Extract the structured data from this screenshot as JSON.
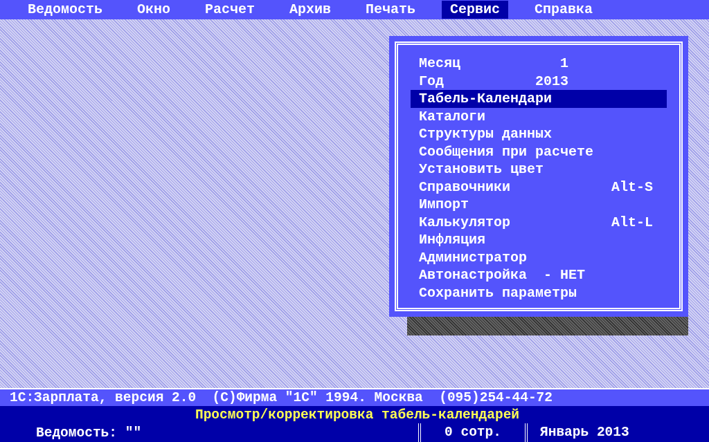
{
  "menu_bar": [
    {
      "label": "Ведомость",
      "selected": false
    },
    {
      "label": "Окно",
      "selected": false
    },
    {
      "label": "Расчет",
      "selected": false
    },
    {
      "label": "Архив",
      "selected": false
    },
    {
      "label": "Печать",
      "selected": false
    },
    {
      "label": "Сервис",
      "selected": true
    },
    {
      "label": "Справка",
      "selected": false
    }
  ],
  "dropdown": {
    "items": [
      {
        "label": "Месяц",
        "value": "1",
        "selected": false
      },
      {
        "label": "Год",
        "value": "2013",
        "selected": false
      },
      {
        "label": "Табель-Календари",
        "selected": true
      },
      {
        "label": "Каталоги",
        "selected": false
      },
      {
        "label": "Структуры данных",
        "selected": false
      },
      {
        "label": "Сообщения при расчете",
        "selected": false
      },
      {
        "label": "Установить цвет",
        "selected": false
      },
      {
        "label": "Справочники",
        "shortcut": "Alt-S",
        "selected": false
      },
      {
        "label": "Импорт",
        "selected": false
      },
      {
        "label": "Калькулятор",
        "shortcut": "Alt-L",
        "selected": false
      },
      {
        "label": "Инфляция",
        "selected": false
      },
      {
        "label": "Администратор",
        "selected": false
      },
      {
        "label": "Автонастройка  - НЕТ",
        "selected": false
      },
      {
        "label": "Сохранить параметры",
        "selected": false
      }
    ]
  },
  "status_line": "1С:Зарплата, версия 2.0  (С)Фирма \"1С\" 1994. Москва  (095)254-44-72",
  "hint": "Просмотр/корректировка табель-календарей",
  "status_bar": {
    "statement": "Ведомость: \"\"",
    "employees": "0 сотр.",
    "period": "Январь 2013"
  }
}
